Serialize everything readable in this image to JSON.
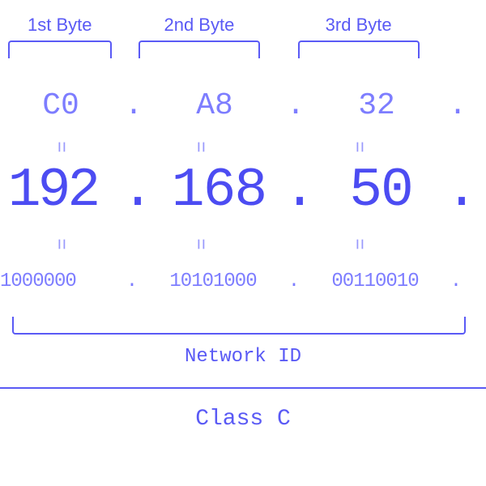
{
  "byte_labels": {
    "b1": "1st Byte",
    "b2": "2nd Byte",
    "b3": "3rd Byte"
  },
  "hex": {
    "o1": "C0",
    "o2": "A8",
    "o3": "32",
    "sep": "."
  },
  "eq": "=",
  "dec": {
    "o1": "192",
    "o2": "168",
    "o3": "50",
    "sep": "."
  },
  "bin": {
    "o1": "1000000",
    "o2": "10101000",
    "o3": "00110010",
    "sep": "."
  },
  "network_id_label": "Network ID",
  "class_label": "Class C"
}
